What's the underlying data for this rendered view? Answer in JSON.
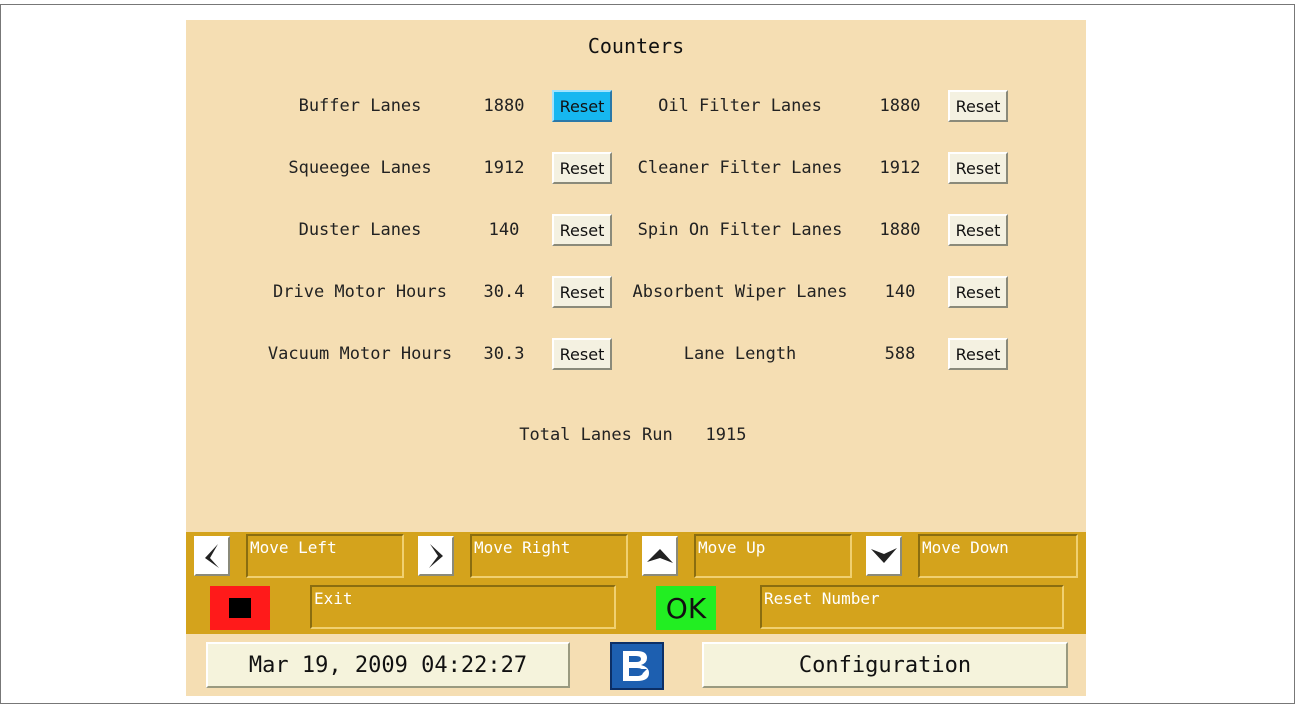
{
  "title": "Counters",
  "counters_left": [
    {
      "label": "Buffer Lanes",
      "value": "1880",
      "button": "Reset"
    },
    {
      "label": "Squeegee Lanes",
      "value": "1912",
      "button": "Reset"
    },
    {
      "label": "Duster Lanes",
      "value": "140",
      "button": "Reset"
    },
    {
      "label": "Drive Motor Hours",
      "value": "30.4",
      "button": "Reset"
    },
    {
      "label": "Vacuum Motor Hours",
      "value": "30.3",
      "button": "Reset"
    }
  ],
  "counters_right": [
    {
      "label": "Oil Filter Lanes",
      "value": "1880",
      "button": "Reset"
    },
    {
      "label": "Cleaner Filter Lanes",
      "value": "1912",
      "button": "Reset"
    },
    {
      "label": "Spin On Filter Lanes",
      "value": "1880",
      "button": "Reset"
    },
    {
      "label": "Absorbent Wiper Lanes",
      "value": "140",
      "button": "Reset"
    },
    {
      "label": "Lane Length",
      "value": "588",
      "button": "Reset"
    }
  ],
  "total": {
    "label": "Total Lanes Run",
    "value": "1915"
  },
  "commands": {
    "move_left": "Move Left",
    "move_right": "Move Right",
    "move_up": "Move Up",
    "move_down": "Move Down",
    "exit": "Exit",
    "ok_label": "OK",
    "reset_number": "Reset Number"
  },
  "footer": {
    "datetime": "Mar 19, 2009 04:22:27",
    "configuration": "Configuration"
  },
  "colors": {
    "panel": "#f5deb3",
    "gold_bar": "#d4a31c",
    "active_button": "#16b7f0",
    "exit_red": "#ff1a1a",
    "ok_green": "#22ee22",
    "logo_blue": "#1d5fb0"
  },
  "icons": {
    "left": "arrow-left-icon",
    "right": "arrow-right-icon",
    "up": "arrow-up-icon",
    "down": "arrow-down-icon",
    "exit": "stop-square-icon",
    "logo": "brand-logo-icon"
  }
}
